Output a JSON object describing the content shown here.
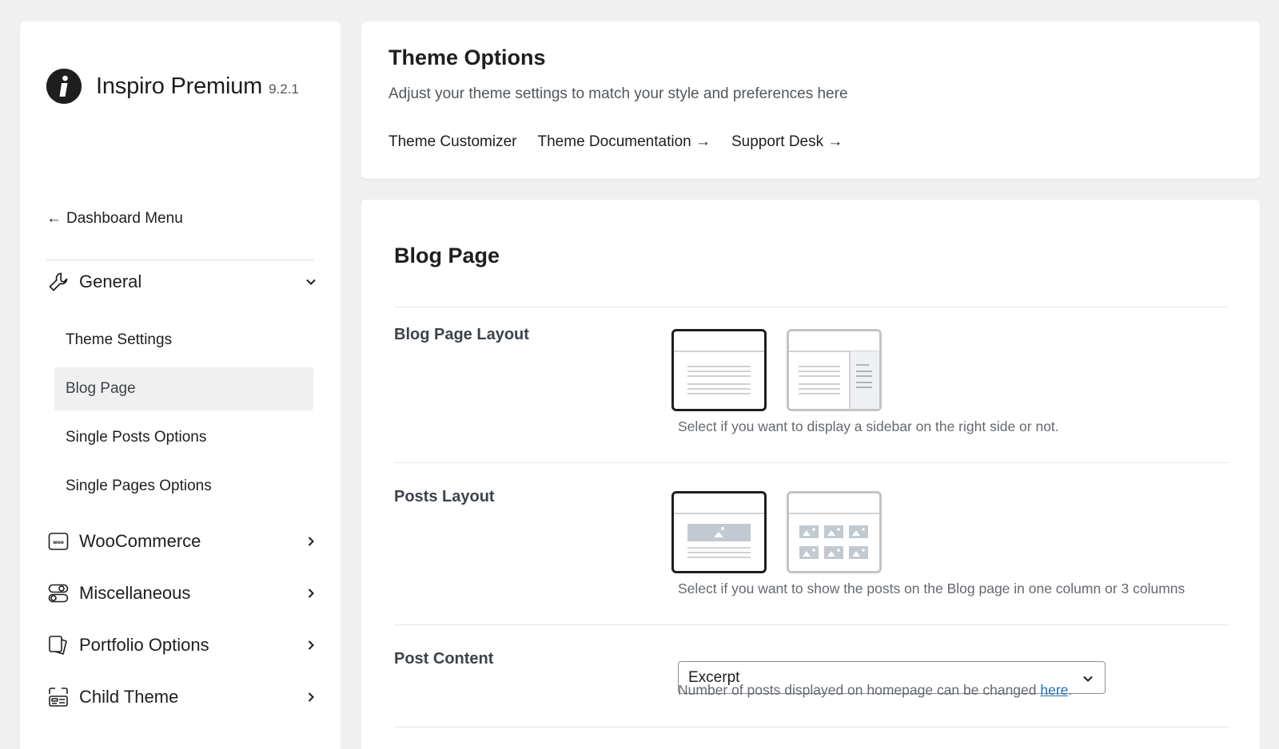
{
  "brand": {
    "name": "Inspiro Premium",
    "version": "9.2.1"
  },
  "sidebar": {
    "back_link": "Dashboard Menu",
    "groups": [
      {
        "label": "General",
        "icon": "wrench-icon",
        "expanded": true
      },
      {
        "label": "WooCommerce",
        "icon": "woo-icon",
        "expanded": false
      },
      {
        "label": "Miscellaneous",
        "icon": "toggles-icon",
        "expanded": false
      },
      {
        "label": "Portfolio Options",
        "icon": "portfolio-icon",
        "expanded": false
      },
      {
        "label": "Child Theme",
        "icon": "child-theme-icon",
        "expanded": false
      }
    ],
    "general_items": [
      {
        "label": "Theme Settings"
      },
      {
        "label": "Blog Page",
        "active": true
      },
      {
        "label": "Single Posts Options"
      },
      {
        "label": "Single Pages Options"
      }
    ]
  },
  "header": {
    "title": "Theme Options",
    "subtitle": "Adjust your theme settings to match your style and preferences here",
    "links": [
      {
        "label": "Theme Customizer"
      },
      {
        "label": "Theme Documentation →"
      },
      {
        "label": "Support Desk →"
      }
    ]
  },
  "main": {
    "section_title": "Blog Page",
    "options": {
      "blog_page_layout": {
        "label": "Blog Page Layout",
        "selected": "full-width",
        "help": "Select if you want to display a sidebar on the right side or not."
      },
      "posts_layout": {
        "label": "Posts Layout",
        "selected": "one-column",
        "help": "Select if you want to show the posts on the Blog page in one column or 3 columns"
      },
      "post_content": {
        "label": "Post Content",
        "value": "Excerpt",
        "help_prefix": "Number of posts displayed on homepage can be changed ",
        "help_link": "here",
        "help_suffix": "."
      }
    }
  },
  "colors": {
    "background": "#f0f0f1",
    "text": "#1e1e1e",
    "link": "#2271b1",
    "muted": "#646970"
  }
}
